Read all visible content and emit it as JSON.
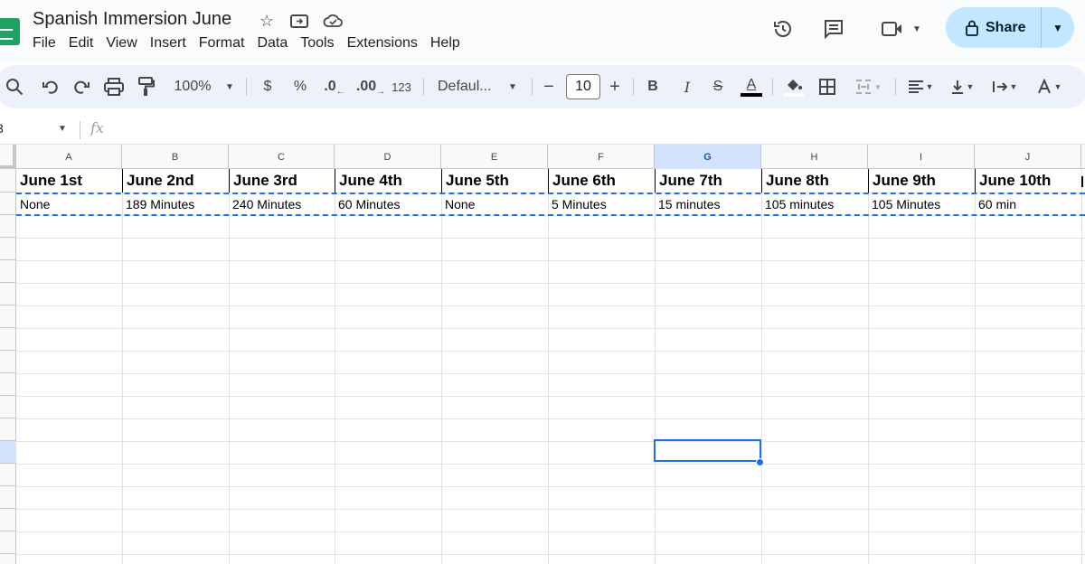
{
  "header": {
    "doc_title": "Spanish Immersion June",
    "menu": [
      "File",
      "Edit",
      "View",
      "Insert",
      "Format",
      "Data",
      "Tools",
      "Extensions",
      "Help"
    ],
    "share_label": "Share"
  },
  "toolbar": {
    "zoom": "100%",
    "currency": "$",
    "percent": "%",
    "decrease_decimal": ".0",
    "increase_decimal": ".00",
    "number_format": "123",
    "font": "Defaul...",
    "font_size": "10",
    "minus": "−",
    "plus": "+",
    "bold": "B",
    "italic": "I",
    "strike": "S",
    "text_color": "A"
  },
  "formula_bar": {
    "cell_ref": "3",
    "fx": "fx"
  },
  "sheet": {
    "columns": [
      "A",
      "B",
      "C",
      "D",
      "E",
      "F",
      "G",
      "H",
      "I",
      "J"
    ],
    "selected_column": "G",
    "row1": [
      "June 1st",
      "June 2nd",
      "June 3rd",
      "June 4th",
      "June 5th",
      "June 6th",
      "June 7th",
      "June 8th",
      "June 9th",
      "June 10th"
    ],
    "row2": [
      "None",
      "189 Minutes",
      "240 Minutes",
      "60 Minutes",
      "None",
      "5 Minutes",
      "15 minutes",
      "105 minutes",
      "105 Minutes",
      "60 min"
    ]
  },
  "colors": {
    "accent": "#1a73e8",
    "share_bg": "#c2e7ff",
    "toolbar_bg": "#edf2fa",
    "selected_header_bg": "#d3e3fd"
  }
}
